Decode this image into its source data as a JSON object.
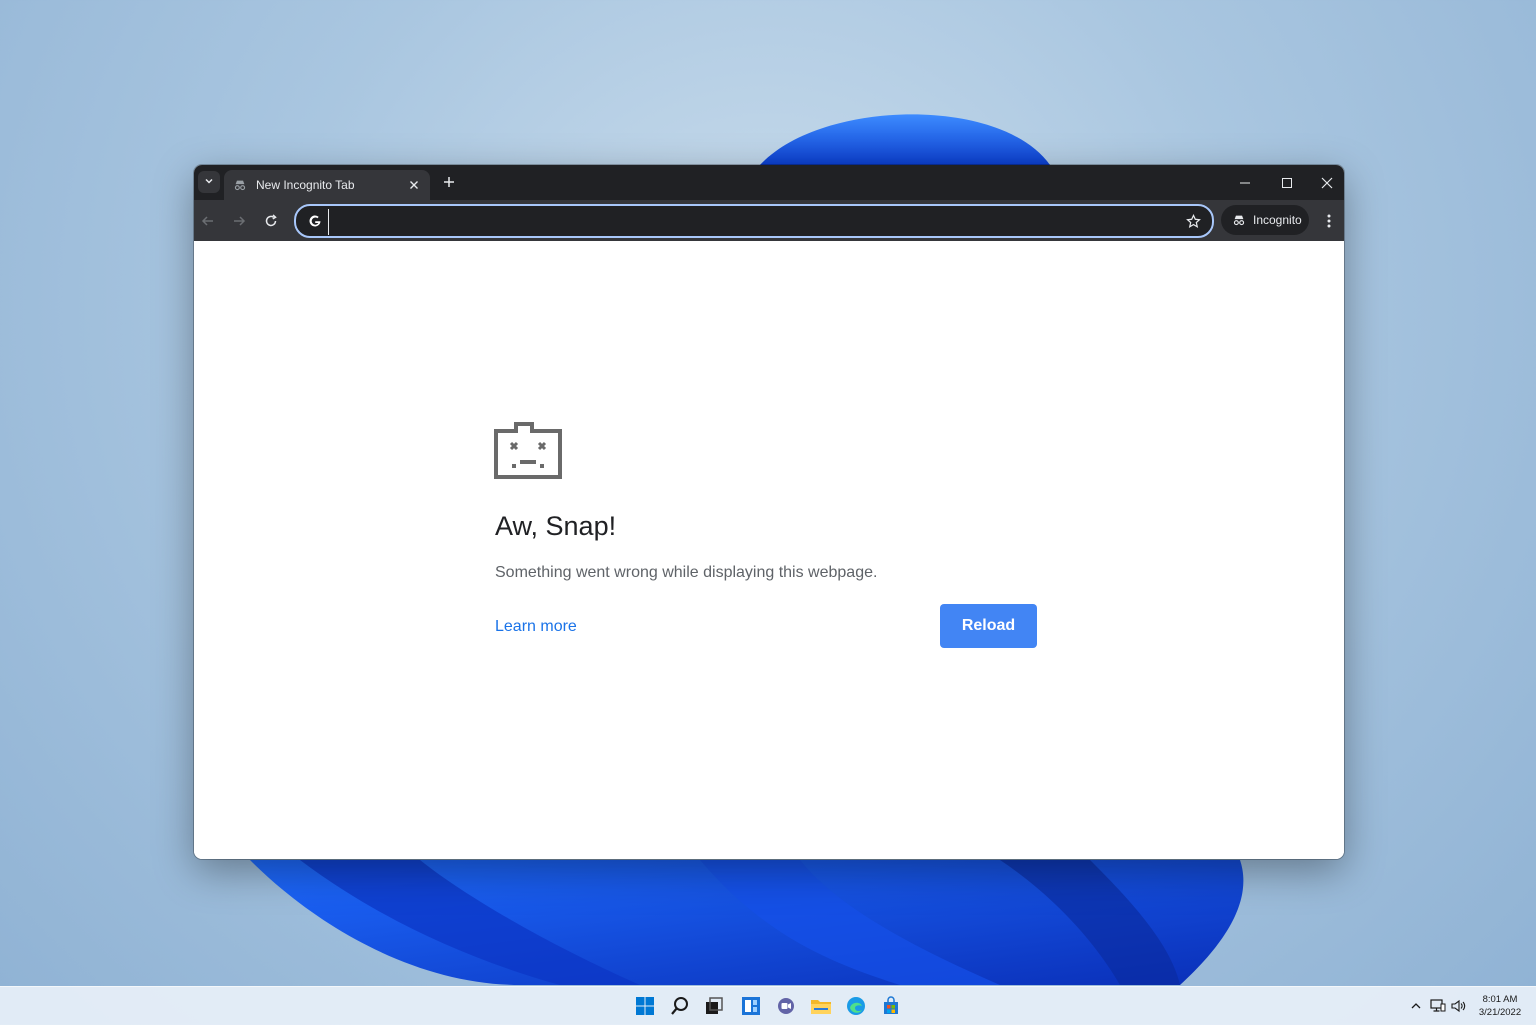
{
  "browser": {
    "tab": {
      "title": "New Incognito Tab"
    },
    "omnibox": {
      "value": "",
      "placeholder": ""
    },
    "profile_chip": {
      "label": "Incognito"
    }
  },
  "error_page": {
    "title": "Aw, Snap!",
    "message": "Something went wrong while displaying this webpage.",
    "learn_more_label": "Learn more",
    "reload_label": "Reload"
  },
  "taskbar": {
    "apps": [
      "start-icon",
      "search-icon",
      "task-view-icon",
      "widgets-icon",
      "chat-icon",
      "file-explorer-icon",
      "edge-icon",
      "store-icon"
    ],
    "clock": {
      "time": "8:01 AM",
      "date": "3/21/2022"
    }
  },
  "colors": {
    "accent": "#4285f4",
    "link": "#1a73e8",
    "titlebar": "#202124",
    "toolbar": "#35363a",
    "focus_ring": "#a8c7fa"
  }
}
